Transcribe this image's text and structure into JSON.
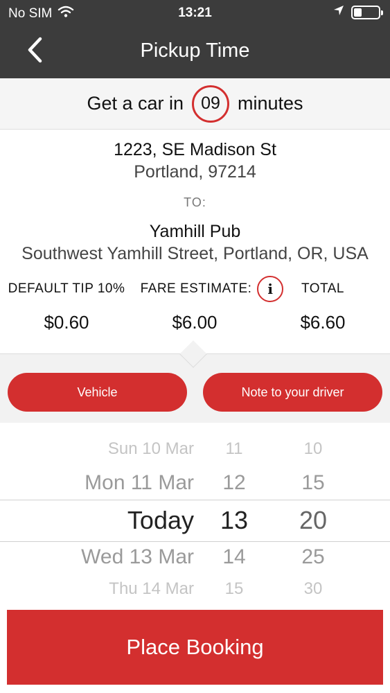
{
  "status_bar": {
    "carrier": "No SIM",
    "time": "13:21"
  },
  "nav": {
    "title": "Pickup Time",
    "back_icon": "chevron-left-icon"
  },
  "eta": {
    "prefix": "Get a car in",
    "minutes": "09",
    "suffix": "minutes"
  },
  "pickup": {
    "line1": "1223, SE Madison St",
    "line2": "Portland, 97214"
  },
  "to_label": "TO:",
  "dropoff": {
    "name": "Yamhill Pub",
    "address": "Southwest Yamhill Street, Portland, OR, USA"
  },
  "fares": {
    "tip_label": "DEFAULT TIP 10%",
    "tip_value": "$0.60",
    "estimate_label": "FARE ESTIMATE:",
    "estimate_value": "$6.00",
    "total_label": "TOTAL",
    "total_value": "$6.60"
  },
  "options": {
    "vehicle_label": "Vehicle",
    "note_label": "Note to your driver"
  },
  "picker": {
    "rows": [
      {
        "date": "Sun 10 Mar",
        "hour": "11",
        "minute": "10"
      },
      {
        "date": "Mon 11 Mar",
        "hour": "12",
        "minute": "15"
      },
      {
        "date": "Today",
        "hour": "13",
        "minute": "20"
      },
      {
        "date": "Wed 13 Mar",
        "hour": "14",
        "minute": "25"
      },
      {
        "date": "Thu 14 Mar",
        "hour": "15",
        "minute": "30"
      }
    ],
    "selected_index": 2
  },
  "booking_button": {
    "label": "Place Booking"
  },
  "colors": {
    "accent": "#d32f2f",
    "header": "#3c3c3c"
  }
}
